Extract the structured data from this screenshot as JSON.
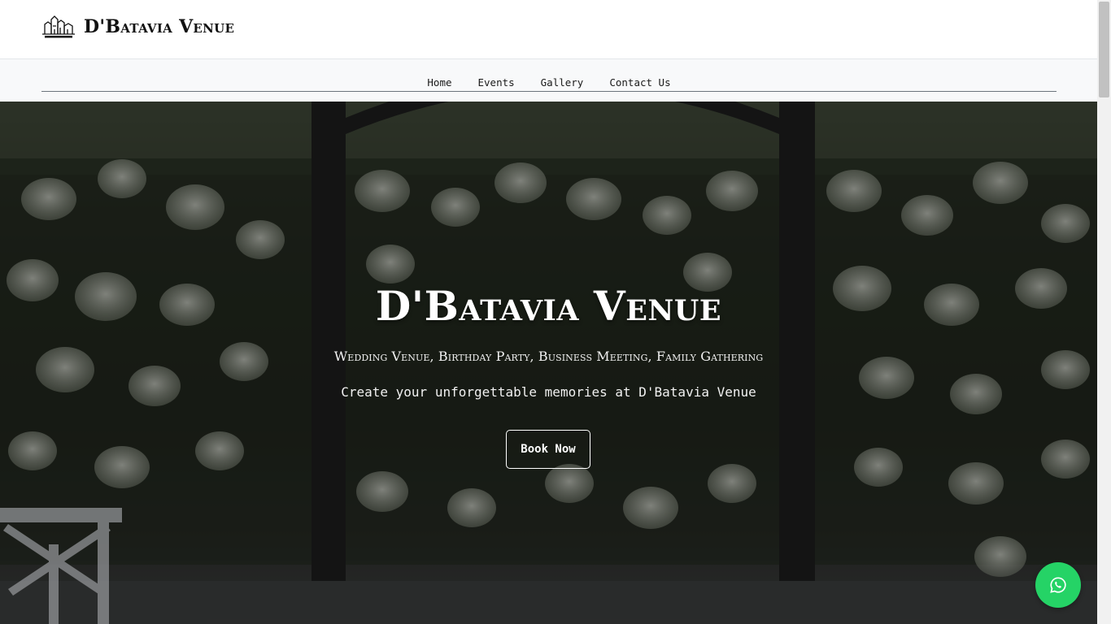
{
  "brand": {
    "name": "D'Batavia Venue",
    "logo_icon": "venue-logo-icon"
  },
  "nav": {
    "items": [
      {
        "label": "Home"
      },
      {
        "label": "Events"
      },
      {
        "label": "Gallery"
      },
      {
        "label": "Contact Us"
      }
    ]
  },
  "hero": {
    "title": "D'Batavia Venue",
    "subtitle": "Wedding Venue, Birthday Party, Business Meeting, Family Gathering",
    "tagline": "Create your unforgettable memories at D'Batavia Venue",
    "cta_label": "Book Now"
  },
  "floating": {
    "whatsapp_icon": "whatsapp-icon",
    "color": "#25d366"
  }
}
